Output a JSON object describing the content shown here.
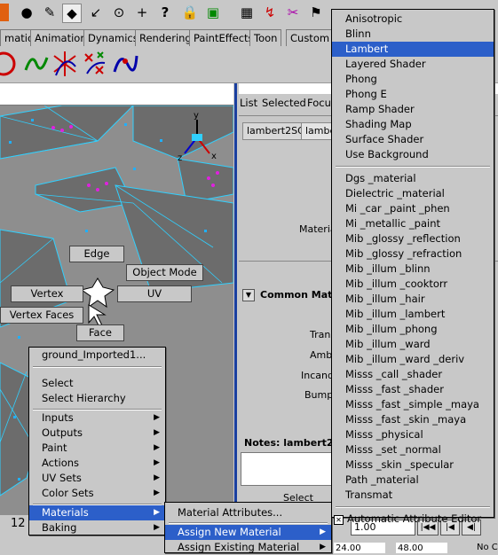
{
  "shelf_tabs": [
    "mation",
    "Animation",
    "Dynamics",
    "Rendering",
    "PaintEffects",
    "Toon",
    "Custom"
  ],
  "toolbar_icons": [
    "stop-icon",
    "dot-icon",
    "paint-icon",
    "diamond-icon",
    "pin-icon",
    "target-icon",
    "plus-icon",
    "question-icon",
    "lock-icon",
    "render-icon",
    "grid-icon",
    "curve-icon",
    "uv-icon"
  ],
  "viewport": {
    "marking_menu": {
      "edge": "Edge",
      "object_mode": "Object Mode",
      "vertex": "Vertex",
      "uv": "UV",
      "vertex_faces": "Vertex Faces",
      "face": "Face"
    }
  },
  "attribute_editor": {
    "menus": [
      "List",
      "Selected",
      "Focus"
    ],
    "tabs": [
      "lambert2SG",
      "lamber"
    ],
    "material_label": "Material",
    "section_title": "Common Mate",
    "attr_labels": [
      "Trans",
      "Ambie",
      "Incande",
      "Bump"
    ],
    "notes_label": "Notes: lambert2",
    "select_button": "Select"
  },
  "context_menu": {
    "header": "ground_Imported1...",
    "items": [
      "Select",
      "Select Hierarchy"
    ],
    "submenus": [
      "Inputs",
      "Outputs",
      "Paint",
      "Actions",
      "UV Sets",
      "Color Sets"
    ],
    "materials": "Materials",
    "baking": "Baking"
  },
  "materials_menu": {
    "items": [
      "Material Attributes...",
      "Assign New Material",
      "Assign Existing Material"
    ]
  },
  "shader_menu": {
    "standard": [
      "Anisotropic",
      "Blinn",
      "Lambert",
      "Layered Shader",
      "Phong",
      "Phong E",
      "Ramp Shader",
      "Shading Map",
      "Surface Shader",
      "Use Background"
    ],
    "mental_ray": [
      "Dgs _material",
      "Dielectric _material",
      "Mi _car _paint _phen",
      "Mi _metallic _paint",
      "Mib _glossy _reflection",
      "Mib _glossy _refraction",
      "Mib _illum _blinn",
      "Mib _illum _cooktorr",
      "Mib _illum _hair",
      "Mib _illum _lambert",
      "Mib _illum _phong",
      "Mib _illum _ward",
      "Mib _illum _ward _deriv",
      "Misss _call _shader",
      "Misss _fast _shader",
      "Misss _fast _simple _maya",
      "Misss _fast _skin _maya",
      "Misss _physical",
      "Misss _set _normal",
      "Misss _skin _specular",
      "Path _material",
      "Transmat"
    ],
    "selected": "Lambert",
    "auto_attr_editor": "Automatic Attribute Editor"
  },
  "bottom": {
    "frame_left": "12",
    "value_field": "1.00",
    "time_start": "24.00",
    "time_end": "48.00",
    "no_label": "No C"
  },
  "colors": {
    "accent": "#2c5fc9",
    "wire": "#30d0ff",
    "face": "#6c6c6c",
    "vertex": "#20b0ff",
    "selected_edge": "#e020e0"
  }
}
